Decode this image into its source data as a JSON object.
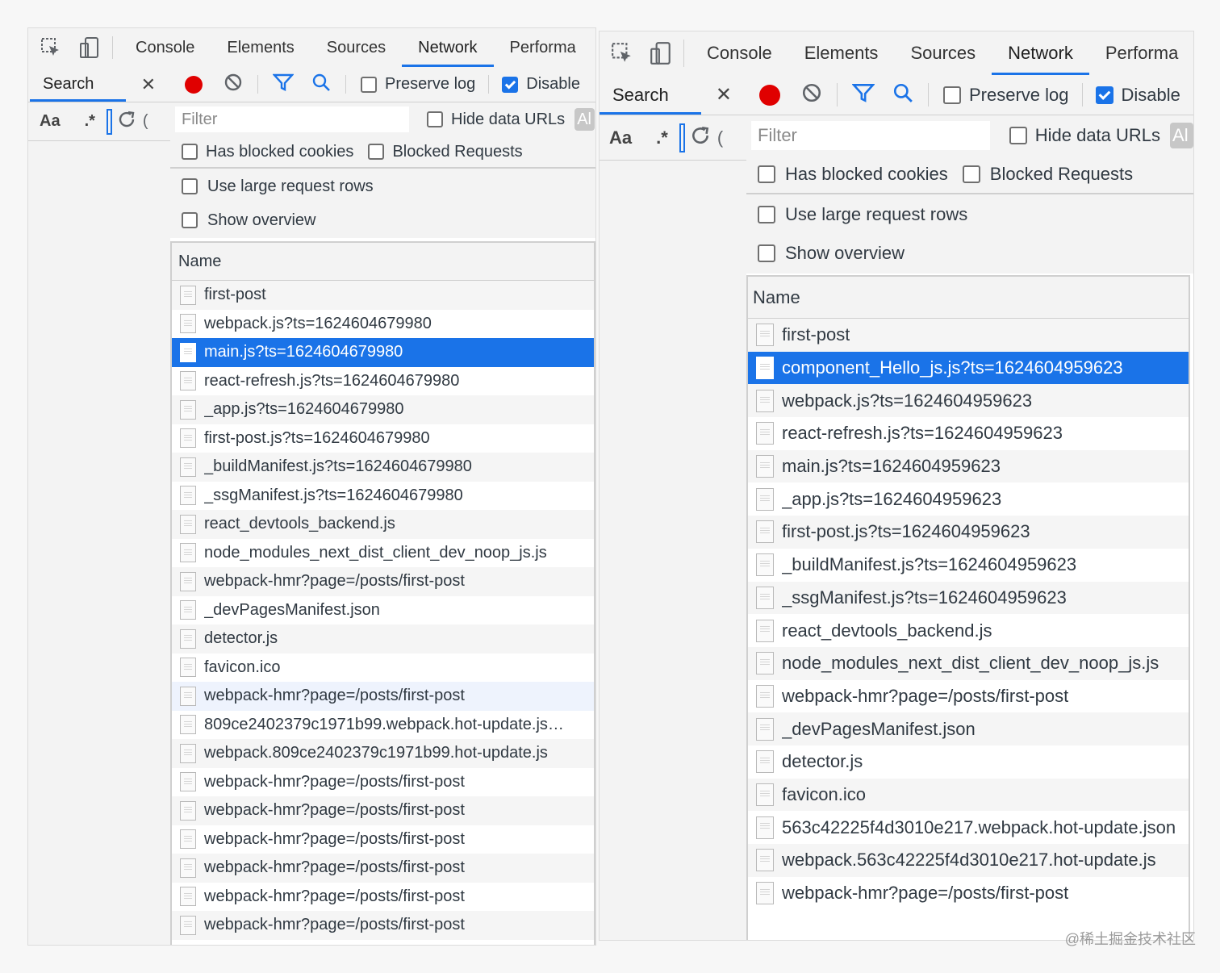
{
  "left": {
    "tabs": [
      "Console",
      "Elements",
      "Sources",
      "Network",
      "Performa"
    ],
    "active_tab": "Network",
    "sidebar": {
      "title": "Search",
      "close": "✕",
      "aa": "Aa",
      "regex": ".*"
    },
    "toolbar": {
      "preserve_log": "Preserve log",
      "disable": "Disable",
      "preserve_log_checked": false,
      "disable_checked": true
    },
    "filter": {
      "placeholder": "Filter",
      "hide_data_urls": "Hide data URLs",
      "all": "Al"
    },
    "options": {
      "has_blocked_cookies": "Has blocked cookies",
      "blocked_requests": "Blocked Requests",
      "large_rows": "Use large request rows",
      "show_overview": "Show overview"
    },
    "table": {
      "header": "Name",
      "rows": [
        "first-post",
        "webpack.js?ts=1624604679980",
        "main.js?ts=1624604679980",
        "react-refresh.js?ts=1624604679980",
        "_app.js?ts=1624604679980",
        "first-post.js?ts=1624604679980",
        "_buildManifest.js?ts=1624604679980",
        "_ssgManifest.js?ts=1624604679980",
        "react_devtools_backend.js",
        "node_modules_next_dist_client_dev_noop_js.js",
        "webpack-hmr?page=/posts/first-post",
        "_devPagesManifest.json",
        "detector.js",
        "favicon.ico",
        "webpack-hmr?page=/posts/first-post",
        "809ce2402379c1971b99.webpack.hot-update.js…",
        "webpack.809ce2402379c1971b99.hot-update.js",
        "webpack-hmr?page=/posts/first-post",
        "webpack-hmr?page=/posts/first-post",
        "webpack-hmr?page=/posts/first-post",
        "webpack-hmr?page=/posts/first-post",
        "webpack-hmr?page=/posts/first-post",
        "webpack-hmr?page=/posts/first-post"
      ],
      "selected_index": 2,
      "hover_index": 14
    }
  },
  "right": {
    "tabs": [
      "Console",
      "Elements",
      "Sources",
      "Network",
      "Performa"
    ],
    "active_tab": "Network",
    "sidebar": {
      "title": "Search",
      "close": "✕",
      "aa": "Aa",
      "regex": ".*"
    },
    "toolbar": {
      "preserve_log": "Preserve log",
      "disable": "Disable",
      "preserve_log_checked": false,
      "disable_checked": true
    },
    "filter": {
      "placeholder": "Filter",
      "hide_data_urls": "Hide data URLs",
      "all": "Al"
    },
    "options": {
      "has_blocked_cookies": "Has blocked cookies",
      "blocked_requests": "Blocked Requests",
      "large_rows": "Use large request rows",
      "show_overview": "Show overview"
    },
    "table": {
      "header": "Name",
      "rows": [
        "first-post",
        "component_Hello_js.js?ts=1624604959623",
        "webpack.js?ts=1624604959623",
        "react-refresh.js?ts=1624604959623",
        "main.js?ts=1624604959623",
        "_app.js?ts=1624604959623",
        "first-post.js?ts=1624604959623",
        "_buildManifest.js?ts=1624604959623",
        "_ssgManifest.js?ts=1624604959623",
        "react_devtools_backend.js",
        "node_modules_next_dist_client_dev_noop_js.js",
        "webpack-hmr?page=/posts/first-post",
        "_devPagesManifest.json",
        "detector.js",
        "favicon.ico",
        "563c42225f4d3010e217.webpack.hot-update.json",
        "webpack.563c42225f4d3010e217.hot-update.js",
        "webpack-hmr?page=/posts/first-post"
      ],
      "selected_index": 1,
      "hover_index": -1
    }
  },
  "watermark": "@稀土掘金技术社区",
  "colors": {
    "accent": "#1a73e8",
    "record": "#e00000"
  }
}
